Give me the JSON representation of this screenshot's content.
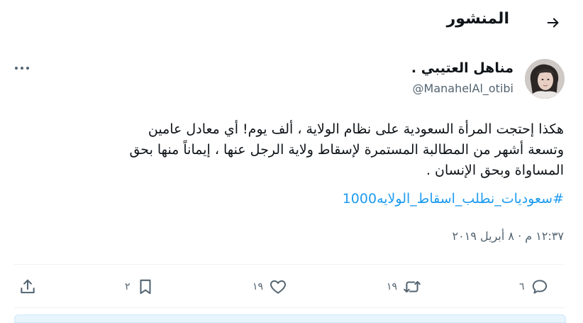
{
  "header": {
    "title": "المنشور",
    "back_icon": "arrow-right-icon"
  },
  "author": {
    "display_name": "مناهل العتيبي .",
    "handle": "@ManahelAl_otibi",
    "avatar_icon": "user-avatar"
  },
  "more_icon": "more-horizontal-icon",
  "tweet": {
    "line1": "هكذا إحتجت المرأة السعودية على نظام الولاية ، ألف يوم! أي معادل عامين",
    "line2": "وتسعة أشهر من المطالبة المستمرة لإسقاط ولاية الرجل عنها ، إيماناً منها بحق",
    "line3": "المساواة وبحق الإنسان .",
    "hashtag": "#سعوديات_نطلب_اسقاط_الولايه1000"
  },
  "timestamp": "١٢:٣٧ م · ٨ أبريل ٢٠١٩",
  "actions": {
    "reply": {
      "icon": "reply-icon",
      "count": "٦"
    },
    "retweet": {
      "icon": "retweet-icon",
      "count": "١٩"
    },
    "like": {
      "icon": "heart-icon",
      "count": "١٩"
    },
    "bookmark": {
      "icon": "bookmark-icon",
      "count": "٢"
    },
    "share": {
      "icon": "share-icon"
    }
  },
  "colors": {
    "accent": "#1d9bf0",
    "muted": "#536471",
    "text": "#0f1419",
    "divider": "#eff3f4"
  }
}
